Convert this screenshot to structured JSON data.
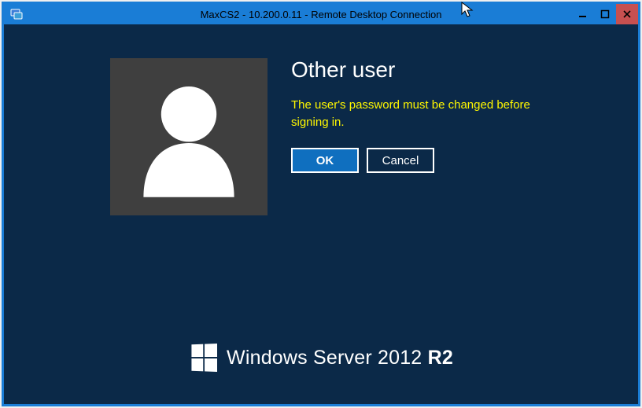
{
  "window": {
    "title": "MaxCS2 - 10.200.0.11 - Remote Desktop Connection"
  },
  "login": {
    "heading": "Other user",
    "message": "The user's password must be changed before signing in.",
    "ok_label": "OK",
    "cancel_label": "Cancel"
  },
  "branding": {
    "name": "Windows Server",
    "year": "2012",
    "suffix": "R2"
  }
}
